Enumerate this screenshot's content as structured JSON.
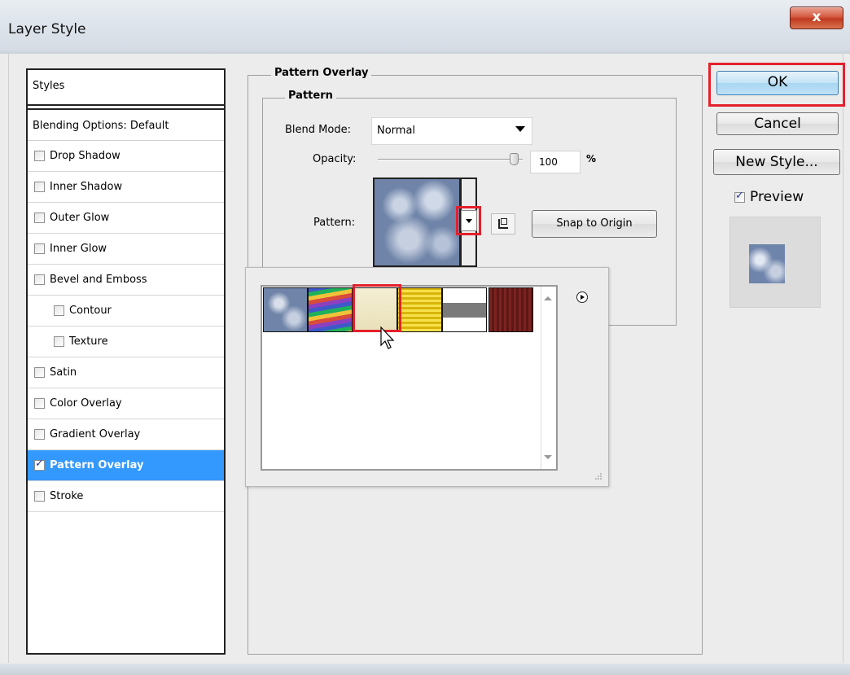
{
  "window": {
    "title": "Layer Style",
    "close_label": "x"
  },
  "styles_panel": {
    "header": "Styles",
    "blending": "Blending Options: Default",
    "items": [
      {
        "label": "Drop Shadow",
        "checked": false,
        "indent": false,
        "selected": false
      },
      {
        "label": "Inner Shadow",
        "checked": false,
        "indent": false,
        "selected": false
      },
      {
        "label": "Outer Glow",
        "checked": false,
        "indent": false,
        "selected": false
      },
      {
        "label": "Inner Glow",
        "checked": false,
        "indent": false,
        "selected": false
      },
      {
        "label": "Bevel and Emboss",
        "checked": false,
        "indent": false,
        "selected": false
      },
      {
        "label": "Contour",
        "checked": false,
        "indent": true,
        "selected": false
      },
      {
        "label": "Texture",
        "checked": false,
        "indent": true,
        "selected": false
      },
      {
        "label": "Satin",
        "checked": false,
        "indent": false,
        "selected": false
      },
      {
        "label": "Color Overlay",
        "checked": false,
        "indent": false,
        "selected": false
      },
      {
        "label": "Gradient Overlay",
        "checked": false,
        "indent": false,
        "selected": false
      },
      {
        "label": "Pattern Overlay",
        "checked": true,
        "indent": false,
        "selected": true
      },
      {
        "label": "Stroke",
        "checked": false,
        "indent": false,
        "selected": false
      }
    ]
  },
  "pattern_overlay": {
    "group_title": "Pattern Overlay",
    "sub_title": "Pattern",
    "blend_mode_label": "Blend Mode:",
    "blend_mode_value": "Normal",
    "opacity_label": "Opacity:",
    "opacity_value": "100",
    "opacity_unit": "%",
    "pattern_label": "Pattern:",
    "snap_button": "Snap to Origin"
  },
  "pattern_picker": {
    "swatches": [
      {
        "name": "bubbles",
        "color": "#6f84a8"
      },
      {
        "name": "rainbow-stripes",
        "color": "#8f6bb5"
      },
      {
        "name": "cream-paper",
        "color": "#efe8c7"
      },
      {
        "name": "yellow-gold",
        "color": "#f2d41a"
      },
      {
        "name": "gray-mesh",
        "color": "#7b7b7b"
      },
      {
        "name": "red-wood",
        "color": "#7a2320"
      }
    ],
    "selected_index": 2
  },
  "buttons": {
    "ok": "OK",
    "cancel": "Cancel",
    "new_style": "New Style...",
    "preview_label": "Preview",
    "preview_checked": true
  },
  "colors": {
    "selection": "#3399ff",
    "highlight": "#e4202c"
  }
}
